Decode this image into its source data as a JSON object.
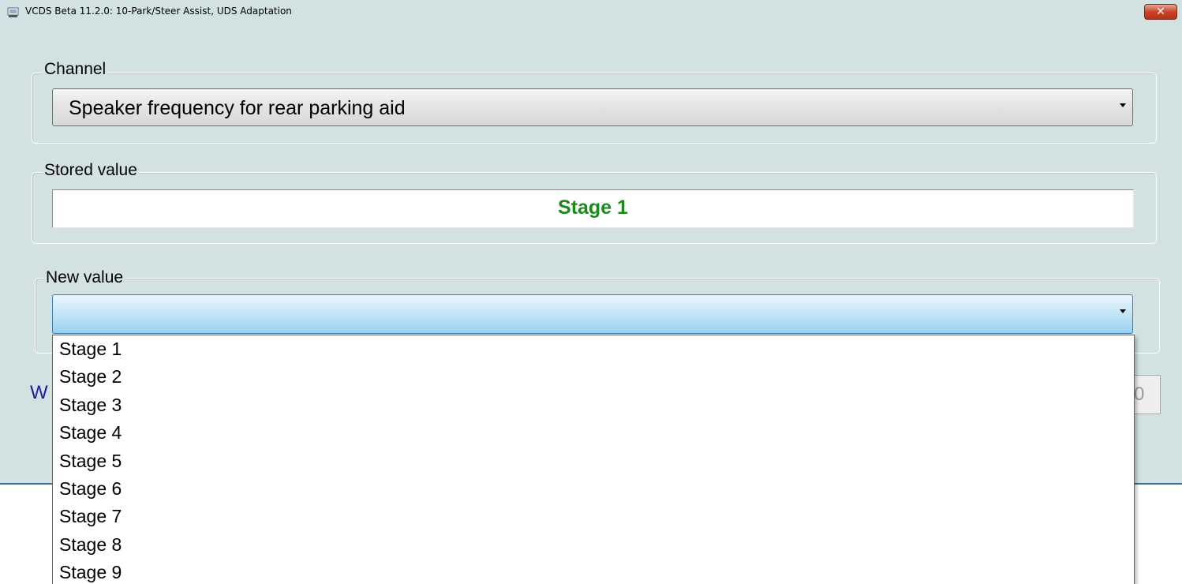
{
  "window": {
    "title": "VCDS Beta 11.2.0: 10-Park/Steer Assist,  UDS Adaptation",
    "close_label": "✕"
  },
  "channel": {
    "legend": "Channel",
    "selected": "Speaker frequency for rear parking aid"
  },
  "stored": {
    "legend": "Stored value",
    "value": "Stage 1",
    "value_color": "#1a8a1a"
  },
  "new_value": {
    "legend": "New value",
    "selected": "",
    "options": [
      "Stage 1",
      "Stage 2",
      "Stage 3",
      "Stage 4",
      "Stage 5",
      "Stage 6",
      "Stage 7",
      "Stage 8",
      "Stage 9"
    ]
  },
  "obscured": {
    "left_label": "W",
    "right_value": "0"
  },
  "icons": {
    "app": "vcds-app-icon",
    "close": "close-icon",
    "dropdown": "chevron-down-icon"
  },
  "colors": {
    "window_bg": "#d2e1e2",
    "close_red": "#c9452a",
    "active_blue": "#98d1ef"
  }
}
